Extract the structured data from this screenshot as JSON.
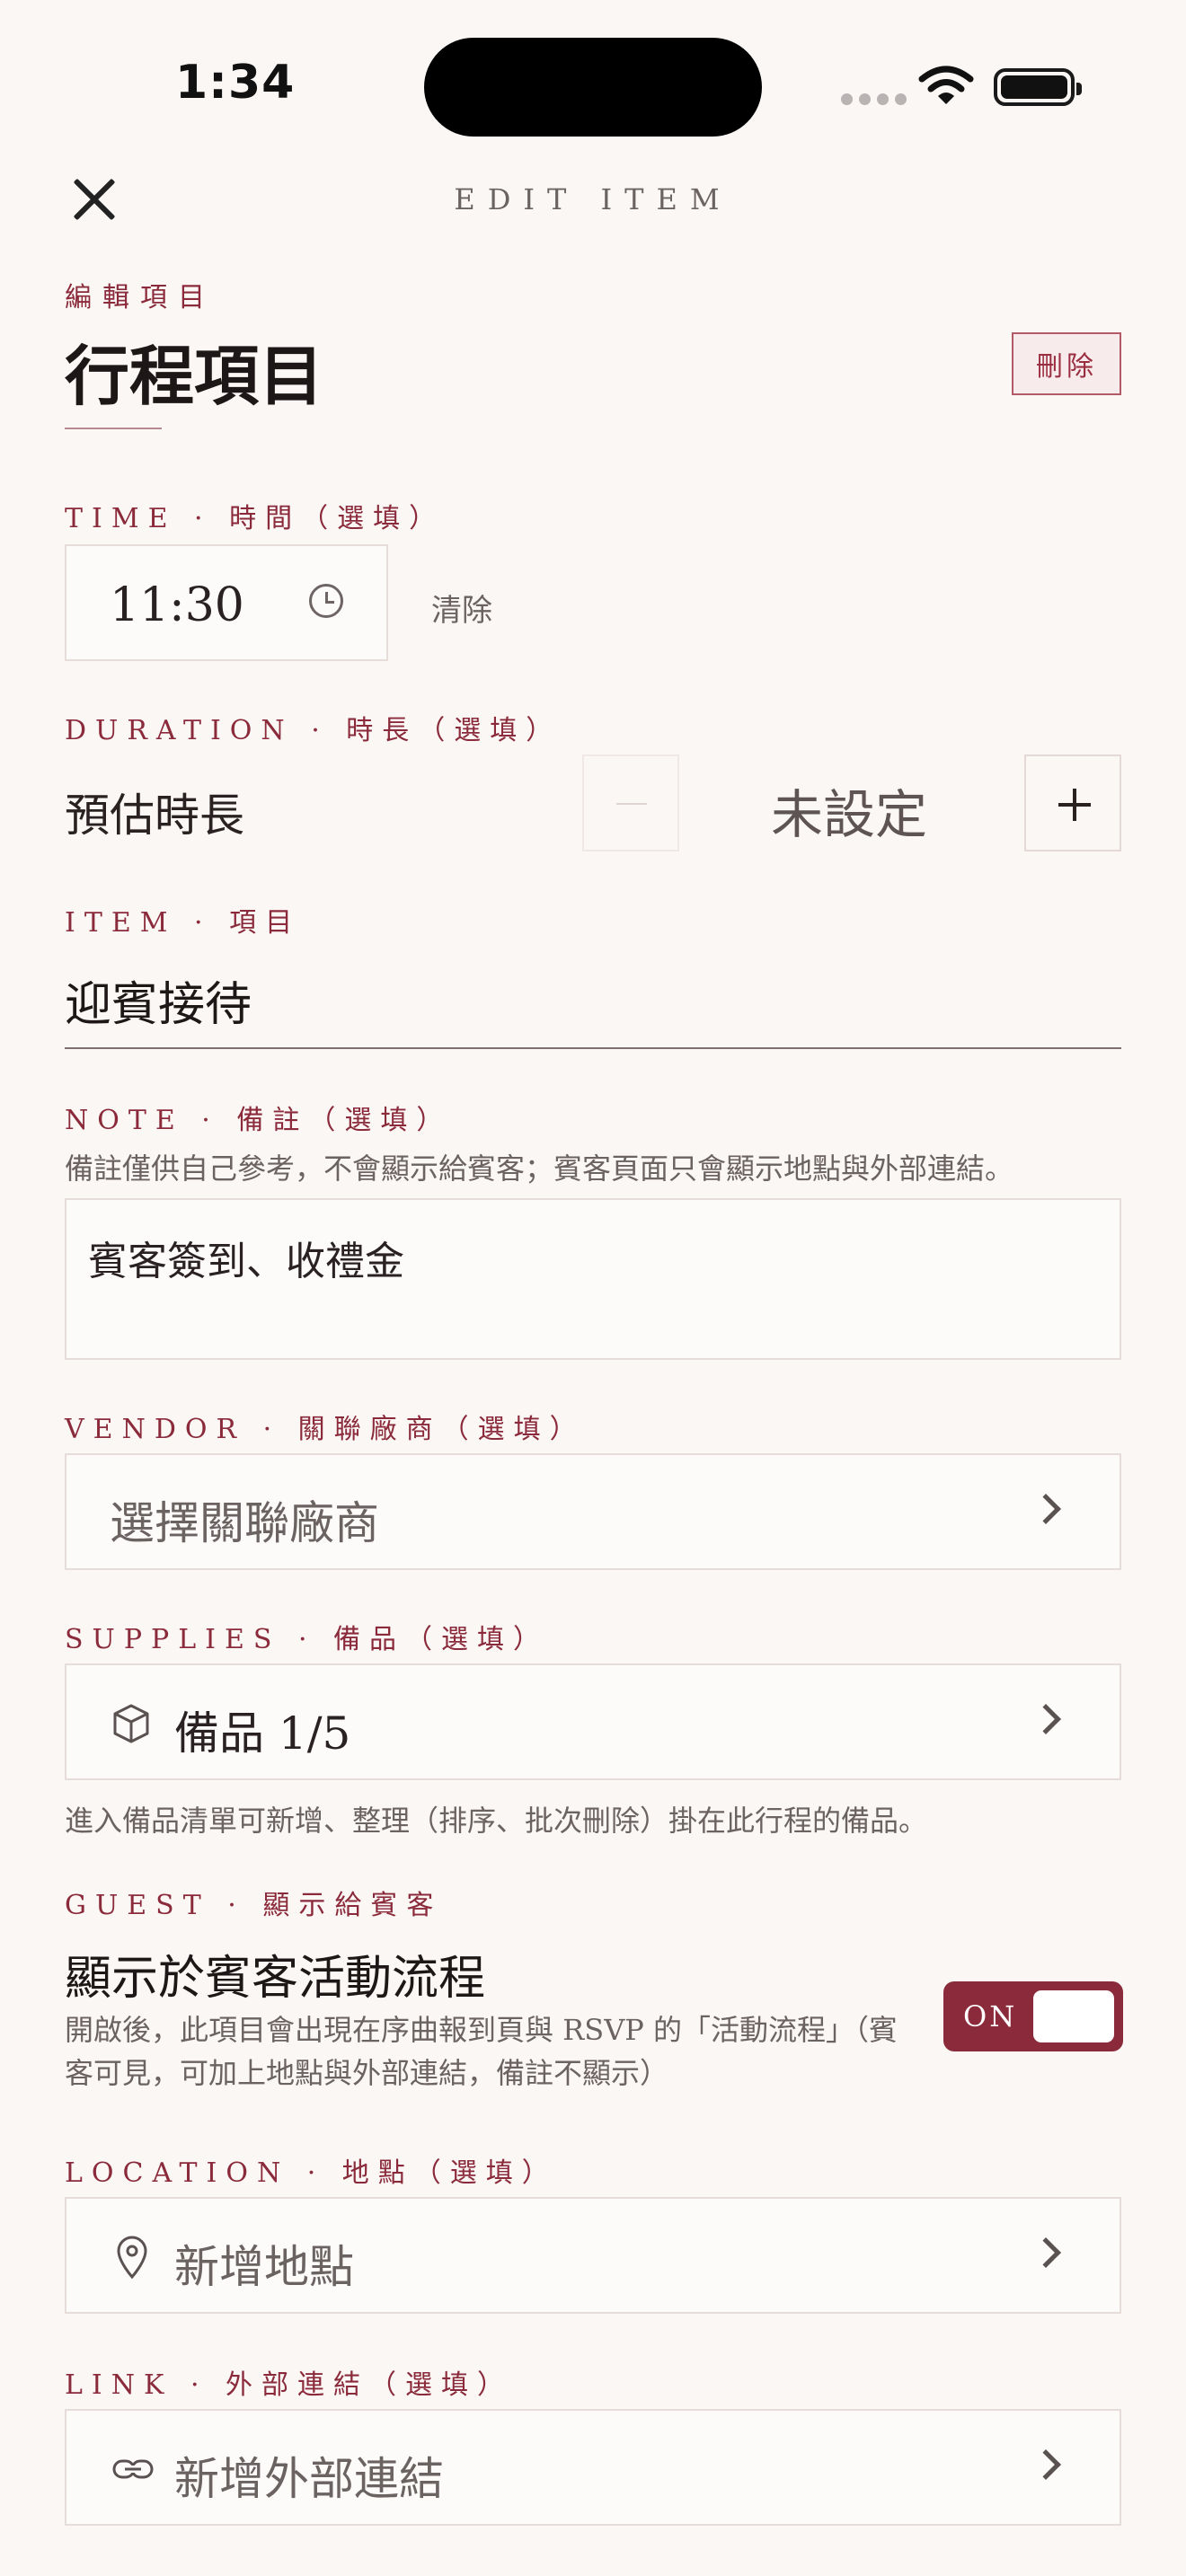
{
  "status_bar": {
    "time": "1:34"
  },
  "header": {
    "nav_title": "EDIT ITEM",
    "kicker": "編輯項目",
    "page_title": "行程項目",
    "delete_label": "刪除"
  },
  "time_section": {
    "label": "TIME · 時間（選填）",
    "value": "11:30",
    "clear_label": "清除"
  },
  "duration_section": {
    "label": "DURATION · 時長（選填）",
    "row_label": "預估時長",
    "value": "未設定"
  },
  "item_section": {
    "label": "ITEM · 項目",
    "value": "迎賓接待"
  },
  "note_section": {
    "label": "NOTE · 備註（選填）",
    "help": "備註僅供自己參考，不會顯示給賓客；賓客頁面只會顯示地點與外部連結。",
    "value": "賓客簽到、收禮金"
  },
  "vendor_section": {
    "label": "VENDOR · 關聯廠商（選填）",
    "placeholder": "選擇關聯廠商"
  },
  "supplies_section": {
    "label": "SUPPLIES · 備品（選填）",
    "value": "備品 1/5",
    "help": "進入備品清單可新增、整理（排序、批次刪除）掛在此行程的備品。"
  },
  "guest_section": {
    "label": "GUEST · 顯示給賓客",
    "title": "顯示於賓客活動流程",
    "description": "開啟後，此項目會出現在序曲報到頁與 RSVP 的「活動流程」（賓客可見，可加上地點與外部連結，備註不顯示）",
    "toggle_label": "ON",
    "toggle_on": true
  },
  "location_section": {
    "label": "LOCATION · 地點（選填）",
    "placeholder": "新增地點"
  },
  "link_section": {
    "label": "LINK · 外部連結（選填）",
    "placeholder": "新增外部連結"
  },
  "colors": {
    "accent": "#8a2a3a",
    "background": "#fbf7f5",
    "border": "#e6dcd9",
    "text": "#2a2222"
  }
}
